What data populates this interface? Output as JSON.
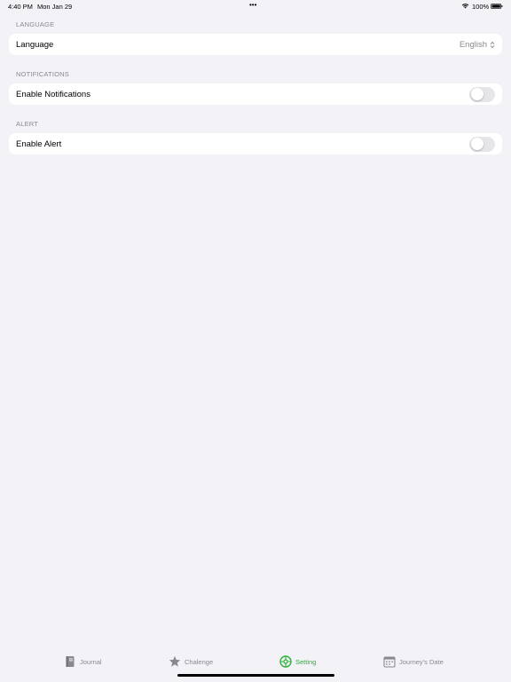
{
  "status_bar": {
    "time": "4:40 PM",
    "date": "Mon Jan 29",
    "dots": "•••",
    "battery_pct": "100%"
  },
  "sections": {
    "language": {
      "header": "LANGUAGE",
      "row_label": "Language",
      "value": "English"
    },
    "notifications": {
      "header": "NOTIFICATIONS",
      "row_label": "Enable Notifications",
      "enabled": false
    },
    "alert": {
      "header": "ALERT",
      "row_label": "Enable Alert",
      "enabled": false
    }
  },
  "tab_bar": {
    "tabs": [
      {
        "label": "Journal",
        "icon": "journal-icon",
        "active": false
      },
      {
        "label": "Chalenge",
        "icon": "star-icon",
        "active": false
      },
      {
        "label": "Setting",
        "icon": "settings-icon",
        "active": true
      },
      {
        "label": "Journey's Date",
        "icon": "calendar-icon",
        "active": false
      }
    ],
    "active_color": "#2db23a",
    "inactive_color": "#8a8a8e"
  }
}
